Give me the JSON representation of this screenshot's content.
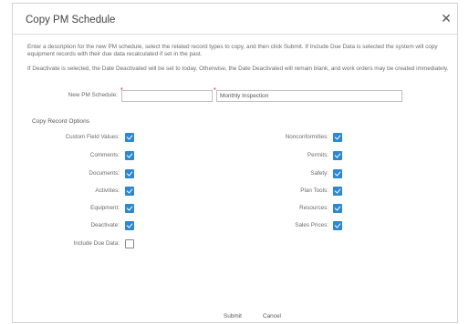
{
  "dialog": {
    "title": "Copy PM Schedule",
    "close_icon": "close-icon"
  },
  "description": {
    "line1": "Enter a description for the new PM schedule, select the related record types to copy, and then click Submit. If Include Due Data is selected the system will copy equipment records with their due data recalculated if set in the past.",
    "line2": "If Deactivate is selected, the Date Deactivated will be set to today. Otherwise, the Date Deactivated will remain blank, and work orders may be created immediately."
  },
  "new_pm": {
    "label": "New PM Schedule:",
    "code_value": "",
    "description_value": "Monthly Inspection",
    "required_marker": "*"
  },
  "section": {
    "title": "Copy Record Options"
  },
  "options_left": [
    {
      "label": "Custom Field Values:",
      "checked": true
    },
    {
      "label": "Comments:",
      "checked": true
    },
    {
      "label": "Documents:",
      "checked": true
    },
    {
      "label": "Activities:",
      "checked": true
    },
    {
      "label": "Equipment:",
      "checked": true
    },
    {
      "label": "Deactivate:",
      "checked": true
    },
    {
      "label": "Include Due Data:",
      "checked": false
    }
  ],
  "options_right": [
    {
      "label": "Nonconformities:",
      "checked": true
    },
    {
      "label": "Permits:",
      "checked": true
    },
    {
      "label": "Safety:",
      "checked": true
    },
    {
      "label": "Plan Tools:",
      "checked": true
    },
    {
      "label": "Resources:",
      "checked": true
    },
    {
      "label": "Sales Prices:",
      "checked": true
    }
  ],
  "footer": {
    "submit_label": "Submit",
    "cancel_label": "Cancel"
  },
  "colors": {
    "checkbox_accent": "#2e88d1",
    "required": "#d0011b"
  }
}
